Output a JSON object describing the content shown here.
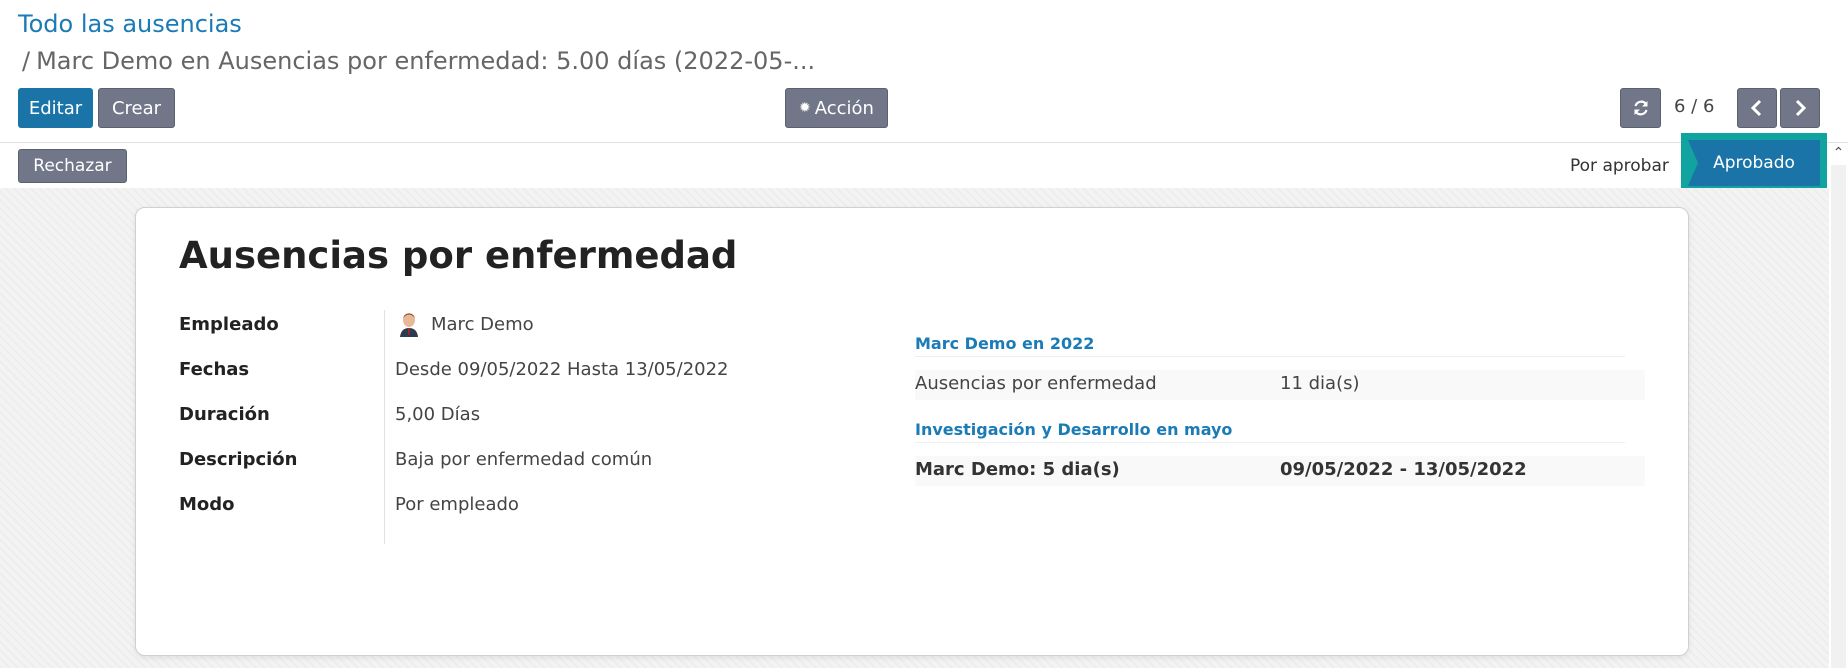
{
  "breadcrumb": {
    "root": "Todo las ausencias",
    "separator": "/",
    "current": "Marc Demo en Ausencias por enfermedad: 5.00 días (2022-05-..."
  },
  "toolbar": {
    "edit_label": "Editar",
    "create_label": "Crear",
    "action_label": "Acción",
    "refresh_icon": "refresh-icon",
    "pager": "6 / 6"
  },
  "statusbar": {
    "reject_label": "Rechazar",
    "stages": [
      {
        "label": "Por aprobar",
        "active": false
      },
      {
        "label": "Aprobado",
        "active": true
      }
    ]
  },
  "form": {
    "title": "Ausencias por enfermedad",
    "fields": [
      {
        "label": "Empleado",
        "value": "Marc Demo"
      },
      {
        "label": "Fechas",
        "value": "Desde 09/05/2022 Hasta 13/05/2022"
      },
      {
        "label": "Duración",
        "value": "5,00 Días"
      },
      {
        "label": "Descripción",
        "value": "Baja por enfermedad común"
      },
      {
        "label": "Modo",
        "value": "Por empleado"
      }
    ]
  },
  "summary": {
    "section1_title": "Marc Demo en 2022",
    "section1_row": {
      "type": "Ausencias por enfermedad",
      "amount": "11 dia(s)"
    },
    "section2_title": "Investigación y Desarrollo en mayo",
    "section2_row": {
      "employee": "Marc Demo: 5 dia(s)",
      "dates": "09/05/2022 - 13/05/2022"
    }
  },
  "colors": {
    "primary": "#1b74a8",
    "link": "#1a7bb6",
    "highlight": "#11a39f",
    "secondary": "#717788"
  }
}
